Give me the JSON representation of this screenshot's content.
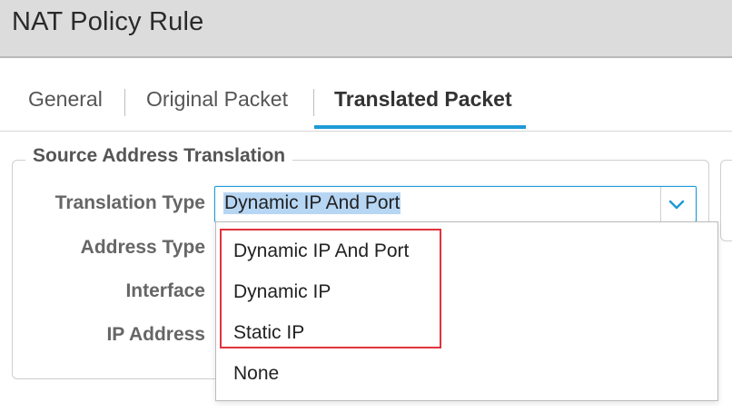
{
  "window": {
    "title": "NAT Policy Rule"
  },
  "tabs": [
    {
      "label": "General",
      "active": false
    },
    {
      "label": "Original Packet",
      "active": false
    },
    {
      "label": "Translated Packet",
      "active": true
    }
  ],
  "source_translation": {
    "legend": "Source Address Translation",
    "labels": {
      "translation_type": "Translation Type",
      "address_type": "Address Type",
      "interface": "Interface",
      "ip_address": "IP Address"
    },
    "translation_type_value": "Dynamic IP And Port",
    "dropdown_options": [
      "Dynamic IP And Port",
      "Dynamic IP",
      "Static IP",
      "None"
    ]
  },
  "colors": {
    "accent": "#1e9ad6",
    "selection_highlight": "#b7d6f4",
    "annotation_box": "#e1333d"
  },
  "icons": {
    "dropdown_toggle": "chevron-down-icon"
  }
}
